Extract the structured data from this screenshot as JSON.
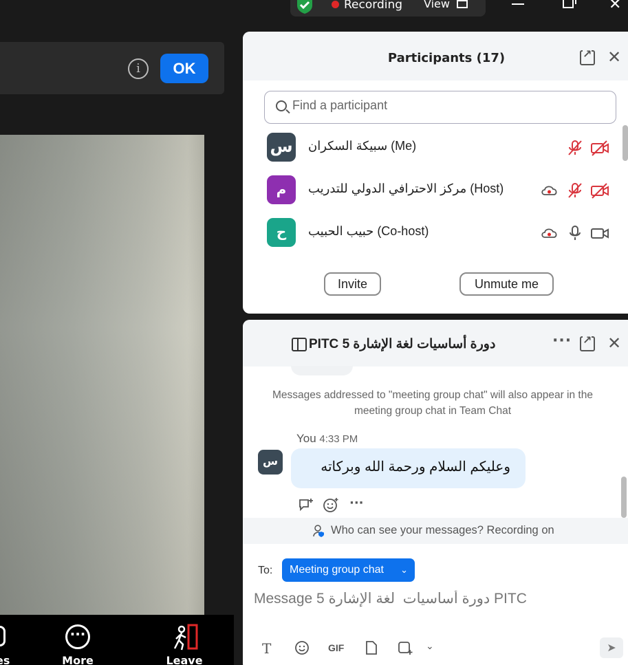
{
  "topbar": {
    "recording_label": "Recording",
    "view_label": "View"
  },
  "banner": {
    "ok_label": "OK",
    "info_glyph": "i"
  },
  "toolbar": {
    "more_label": "More",
    "leave_label": "Leave",
    "partial_label": "es"
  },
  "participants": {
    "title": "Participants (17)",
    "search_placeholder": "Find a participant",
    "items": [
      {
        "avatar": "س",
        "avatar_color": "#3b4a56",
        "name": "سبيكة السكران (Me)",
        "recording": false,
        "mic": "muted",
        "video": "off"
      },
      {
        "avatar": "م",
        "avatar_color": "#8e2fb0",
        "name": "مركز الاحترافي الدولي للتدريب (Host)",
        "recording": true,
        "mic": "muted",
        "video": "off"
      },
      {
        "avatar": "ح",
        "avatar_color": "#1aa58a",
        "name": "حبيب الحبيب (Co-host)",
        "recording": true,
        "mic": "on",
        "video": "on"
      }
    ],
    "invite_label": "Invite",
    "unmute_label": "Unmute me"
  },
  "chat": {
    "title": "PITC دورة أساسيات  لغة الإشارة 5",
    "system_message": "Messages addressed to \"meeting group chat\" will also appear in the meeting group chat in Team Chat",
    "message": {
      "sender": "You",
      "time": "4:33 PM",
      "avatar": "س",
      "text": "وعليكم السلام ورحمة الله وبركاته"
    },
    "visibility_notice": "Who can see your messages? Recording on",
    "to_label": "To:",
    "to_value": "Meeting group chat",
    "input_placeholder": "Message دورة أساسيات  لغة الإشارة 5 PITC",
    "gif_label": "GIF"
  },
  "colors": {
    "accent": "#0e72ed",
    "muted_red": "#d9363e",
    "rec_red": "#e02828"
  }
}
